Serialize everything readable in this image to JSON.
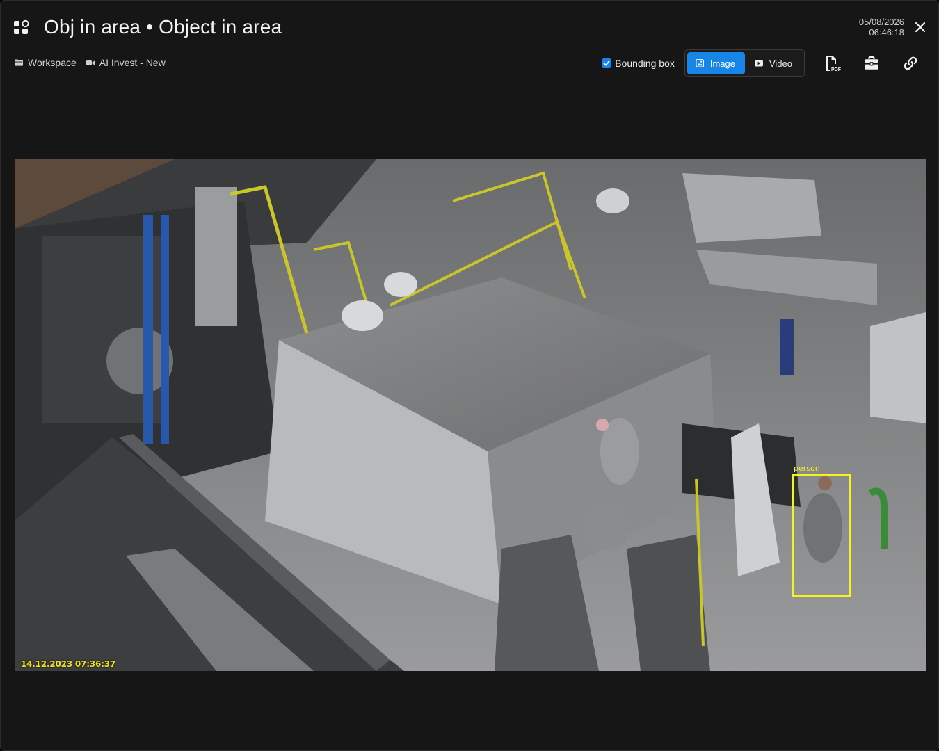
{
  "header": {
    "title": "Obj in area • Object in area",
    "date": "05/08/2026",
    "time": "06:46:18"
  },
  "breadcrumb": {
    "workspace": "Workspace",
    "camera": "AI Invest - New"
  },
  "toolbar": {
    "bounding_box_label": "Bounding box",
    "bounding_box_checked": true,
    "image_label": "Image",
    "video_label": "Video",
    "active_view": "Image"
  },
  "frame": {
    "timestamp": "14.12.2023 07:36:37",
    "detection": {
      "label": "person"
    }
  },
  "colors": {
    "accent": "#1685e6",
    "bbox": "#f6f21a",
    "background": "#161616"
  },
  "icons": {
    "app": "grid-group-icon",
    "close": "close-icon",
    "workspace": "folder-icon",
    "camera": "video-camera-icon",
    "image": "image-icon",
    "video": "video-icon",
    "pdf": "pdf-export-icon",
    "case": "briefcase-icon",
    "link": "link-icon"
  }
}
